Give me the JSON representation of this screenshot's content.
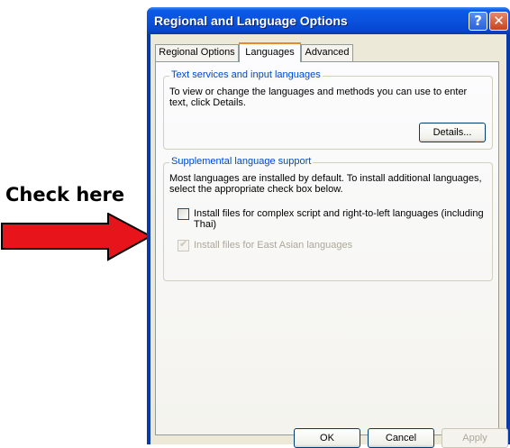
{
  "annotation": {
    "label": "Check here"
  },
  "window": {
    "title": "Regional and Language Options"
  },
  "titlebar": {
    "help_glyph": "?",
    "close_glyph": "✕"
  },
  "tabs": [
    {
      "label": "Regional Options"
    },
    {
      "label": "Languages"
    },
    {
      "label": "Advanced"
    }
  ],
  "text_services": {
    "title": "Text services and input languages",
    "description": "To view or change the languages and methods you can use to enter text, click Details.",
    "details_button": "Details..."
  },
  "supplemental": {
    "title": "Supplemental language support",
    "description": "Most languages are installed by default. To install additional languages, select the appropriate check box below.",
    "complex_script_label": "Install files for complex script and right-to-left languages (including Thai)",
    "complex_script_checked": false,
    "east_asian_label": "Install files for East Asian languages",
    "east_asian_checked": true,
    "east_asian_disabled": true
  },
  "footer": {
    "ok": "OK",
    "cancel": "Cancel",
    "apply": "Apply"
  },
  "colors": {
    "arrow": "#e8141c",
    "titlebar": "#0a52de",
    "group_title": "#0046d5"
  }
}
